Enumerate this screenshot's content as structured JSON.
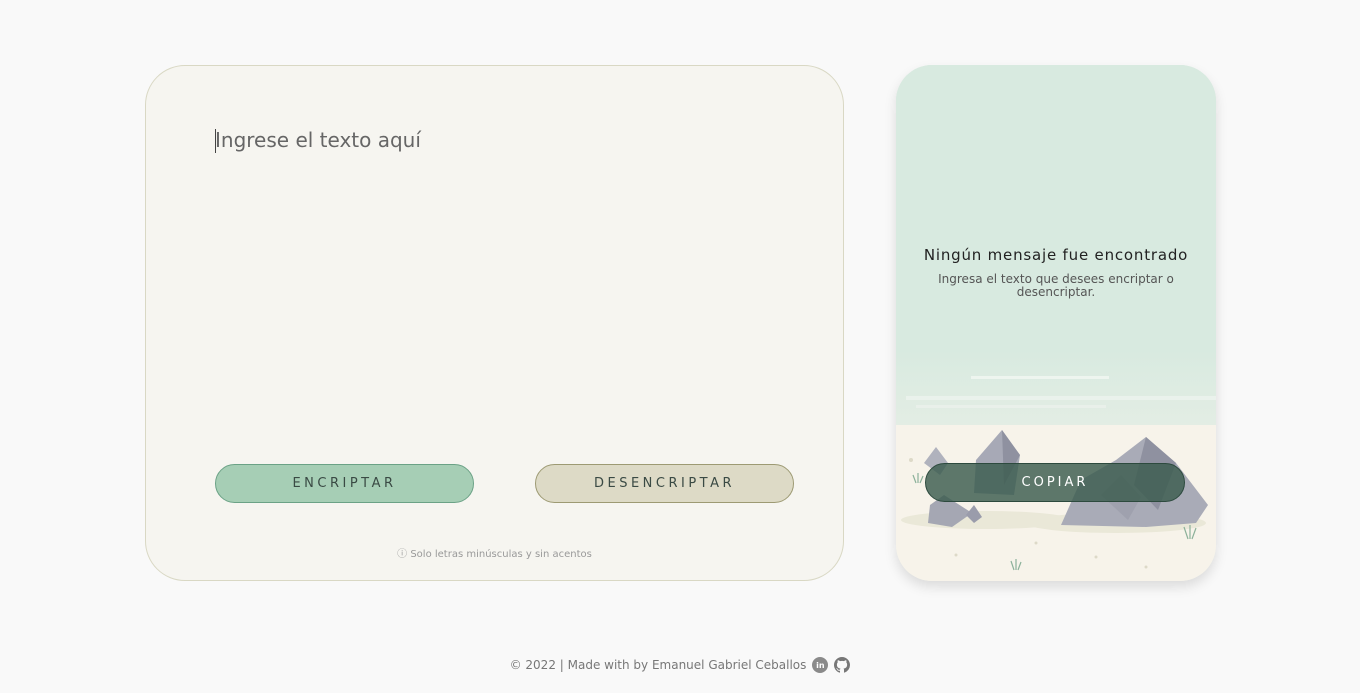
{
  "input": {
    "placeholder": "Ingrese el texto aquí",
    "value": ""
  },
  "buttons": {
    "encrypt": "ENCRIPTAR",
    "decrypt": "DESENCRIPTAR",
    "copy": "COPIAR"
  },
  "hint": "ⓘ Solo letras minúsculas y sin acentos",
  "result": {
    "title": "Ningún mensaje fue encontrado",
    "subtitle": "Ingresa el texto que desees encriptar o desencriptar."
  },
  "footer": {
    "text": "© 2022 | Made with by Emanuel Gabriel Ceballos",
    "icons": [
      "linkedin-icon",
      "github-icon"
    ],
    "linkedin_glyph": "in"
  },
  "colors": {
    "encrypt_bg": "#a6ceb5",
    "decrypt_bg": "#dddac6",
    "copy_bg": "#3a5c4e",
    "result_bg": "#d8eae0"
  }
}
